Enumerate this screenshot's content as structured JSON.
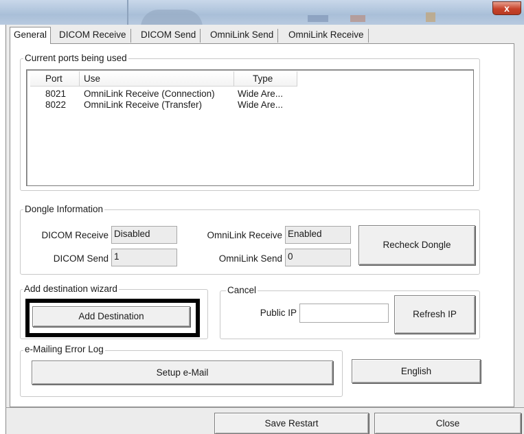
{
  "window": {
    "close_label": "x"
  },
  "tabs": [
    {
      "label": "General",
      "active": true
    },
    {
      "label": "DICOM Receive"
    },
    {
      "label": "DICOM Send"
    },
    {
      "label": "OmniLink Send"
    },
    {
      "label": "OmniLink Receive"
    }
  ],
  "ports": {
    "group_label": "Current ports being used",
    "columns": [
      "Port",
      "Use",
      "Type"
    ],
    "rows": [
      {
        "port": "8021",
        "use": "OmniLink Receive (Connection)",
        "type": "Wide Are..."
      },
      {
        "port": "8022",
        "use": "OmniLink Receive (Transfer)",
        "type": "Wide Are..."
      }
    ]
  },
  "dongle": {
    "group_label": "Dongle Information",
    "dicom_receive_label": "DICOM Receive",
    "dicom_receive_value": "Disabled",
    "dicom_send_label": "DICOM Send",
    "dicom_send_value": "1",
    "omnilink_receive_label": "OmniLink Receive",
    "omnilink_receive_value": "Enabled",
    "omnilink_send_label": "OmniLink Send",
    "omnilink_send_value": "0",
    "recheck_label": "Recheck Dongle"
  },
  "wizard": {
    "group_label": "Add destination wizard",
    "add_label": "Add Destination"
  },
  "cancel": {
    "group_label": "Cancel",
    "public_ip_label": "Public IP",
    "public_ip_value": "",
    "refresh_label": "Refresh IP"
  },
  "email": {
    "group_label": "e-Mailing Error Log",
    "setup_label": "Setup e-Mail"
  },
  "language_label": "English",
  "footer": {
    "save_label": "Save Restart",
    "close_label": "Close"
  },
  "colors": {
    "highlight": "#000000",
    "close_button": "#c7432b"
  }
}
